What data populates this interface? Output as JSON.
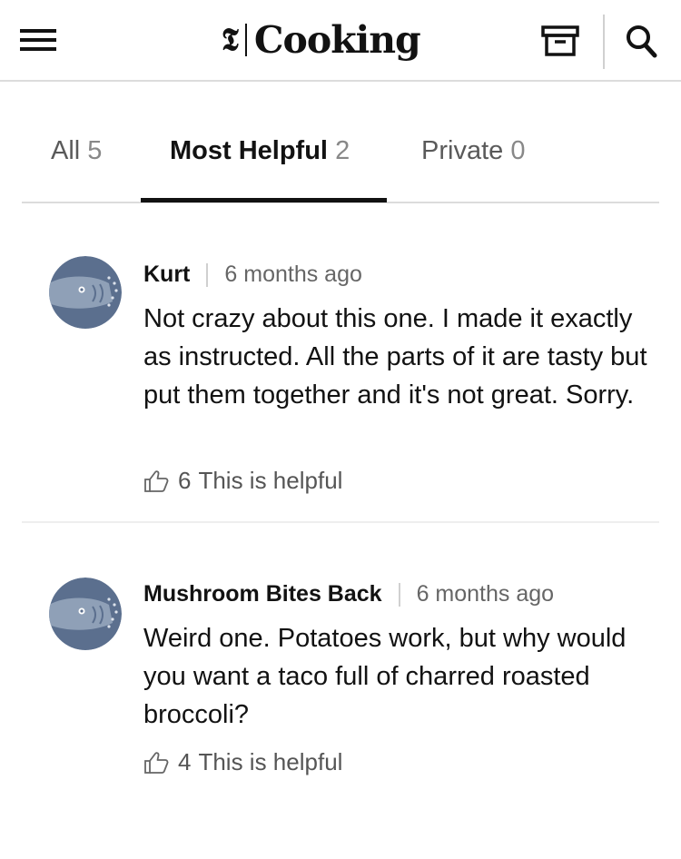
{
  "header": {
    "brand_mark": "𝕿",
    "brand_word": "Cooking",
    "menu_icon": "hamburger-menu-icon",
    "box_icon": "recipe-box-icon",
    "search_icon": "search-icon"
  },
  "tabs": [
    {
      "label": "All",
      "count": "5",
      "active": false
    },
    {
      "label": "Most Helpful",
      "count": "2",
      "active": true
    },
    {
      "label": "Private",
      "count": "0",
      "active": false
    }
  ],
  "comments": [
    {
      "author": "Kurt",
      "time": "6 months ago",
      "text": "Not crazy about this one. I made it exactly as instructed. All the parts of it are tasty but put them together and it's not great. Sorry.",
      "helpful_count": "6",
      "helpful_label": "This is helpful"
    },
    {
      "author": "Mushroom Bites Back",
      "time": "6 months ago",
      "text": "Weird one. Potatoes work, but why would you want a taco full of charred roasted broccoli?",
      "helpful_count": "4",
      "helpful_label": "This is helpful"
    }
  ],
  "colors": {
    "text": "#121212",
    "muted": "#666666",
    "avatar_bg": "#5b6f8e",
    "fish": "#8fa0b7",
    "divider": "#dcdcdc"
  }
}
